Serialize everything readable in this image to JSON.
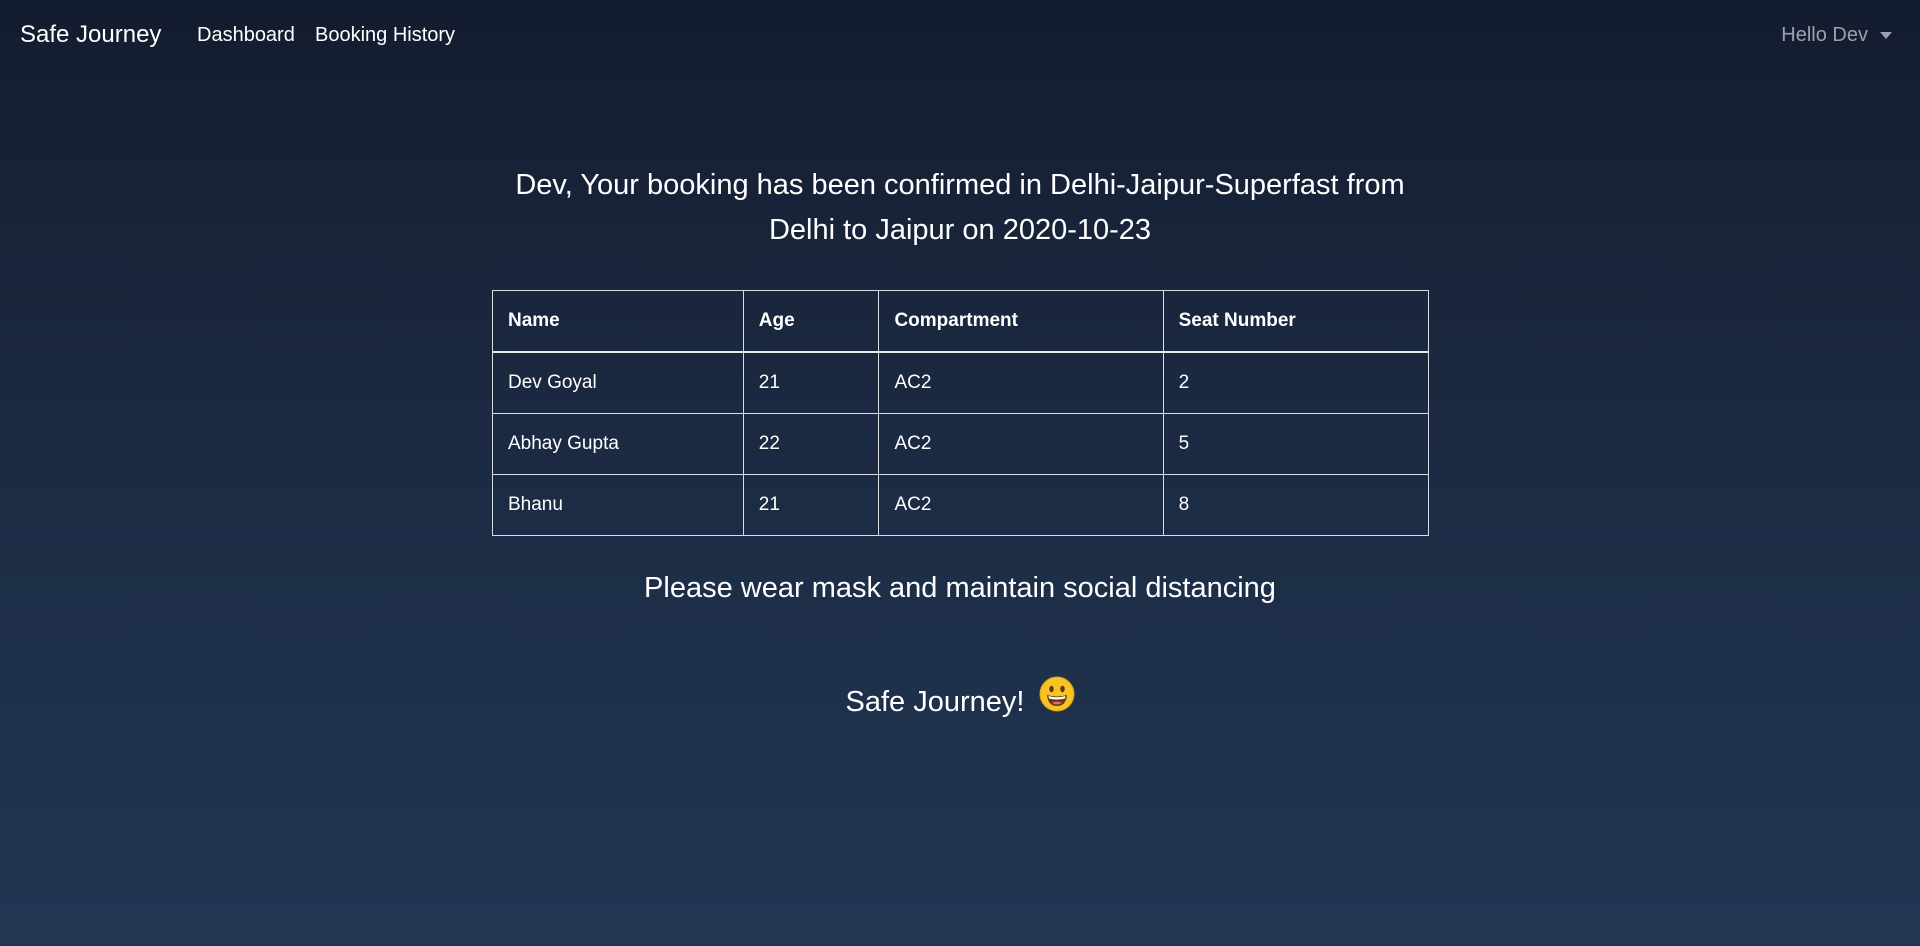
{
  "navbar": {
    "brand": "Safe Journey",
    "links": [
      {
        "label": "Dashboard"
      },
      {
        "label": "Booking History"
      }
    ],
    "user_menu": {
      "label": "Hello Dev",
      "icon": "caret-down-icon"
    }
  },
  "confirmation": {
    "line1": "Dev, Your booking has been confirmed in Delhi-Jaipur-Superfast from",
    "line2": "Delhi to Jaipur on 2020-10-23"
  },
  "passengers_table": {
    "headers": [
      "Name",
      "Age",
      "Compartment",
      "Seat Number"
    ],
    "rows": [
      [
        "Dev Goyal",
        "21",
        "AC2",
        "2"
      ],
      [
        "Abhay Gupta",
        "22",
        "AC2",
        "5"
      ],
      [
        "Bhanu",
        "21",
        "AC2",
        "8"
      ]
    ]
  },
  "advice": "Please wear mask and maintain social distancing",
  "farewell": {
    "text": "Safe Journey!",
    "icon": "grinning-face-emoji-icon"
  },
  "colors": {
    "background_top": "#141c2f",
    "background_bottom": "#223653",
    "text": "#ffffff",
    "muted_text": "#9aa1ab",
    "table_border": "#d9dde3",
    "emoji_yellow": "#f7c325"
  }
}
